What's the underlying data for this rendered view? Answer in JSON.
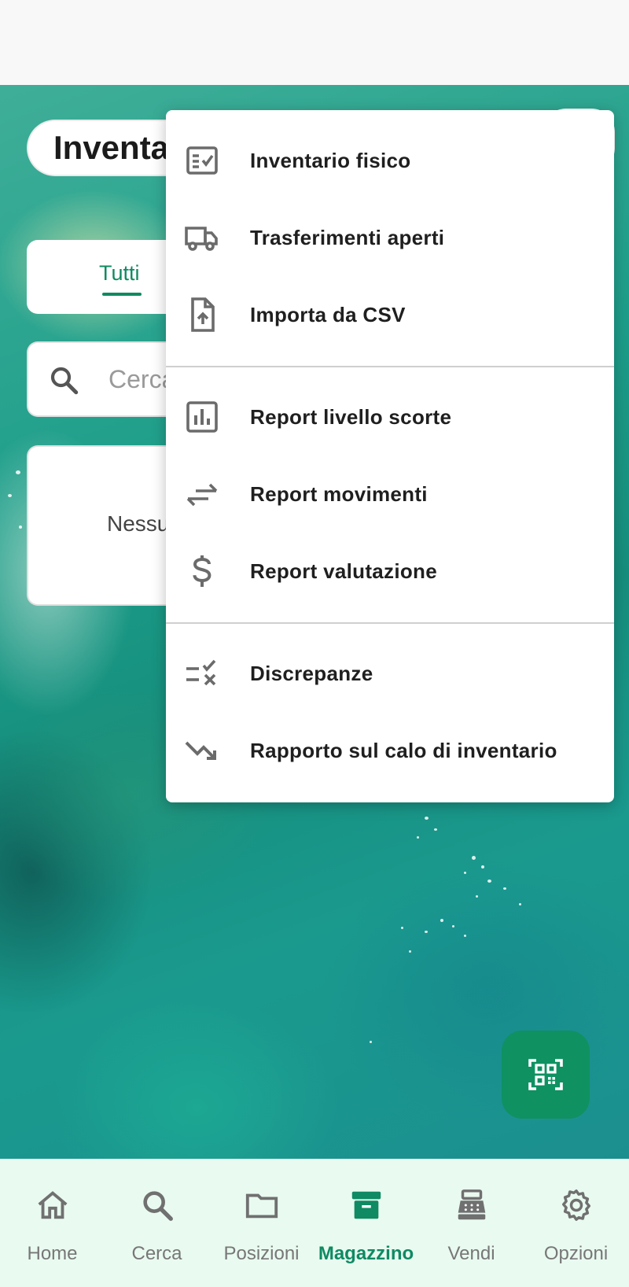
{
  "screen_title": "Inventa",
  "tabs": {
    "active_label": "Tutti"
  },
  "search": {
    "placeholder": "Cerca"
  },
  "empty_state": {
    "text": "Nessu"
  },
  "menu": {
    "items": [
      {
        "label": "Inventario fisico",
        "icon": "checklist-icon"
      },
      {
        "label": "Trasferimenti aperti",
        "icon": "truck-icon"
      },
      {
        "label": "Importa da CSV",
        "icon": "file-upload-icon"
      },
      {
        "label": "Report livello scorte",
        "icon": "bar-chart-icon"
      },
      {
        "label": "Report movimenti",
        "icon": "swap-arrows-icon"
      },
      {
        "label": "Report valutazione",
        "icon": "dollar-icon"
      },
      {
        "label": "Discrepanze",
        "icon": "rule-icon"
      },
      {
        "label": "Rapporto sul calo di inventario",
        "icon": "trending-down-icon"
      }
    ]
  },
  "fab": {
    "icon": "qr-scan-icon"
  },
  "bottom_nav": {
    "active_index": 3,
    "items": [
      {
        "label": "Home",
        "icon": "home-icon"
      },
      {
        "label": "Cerca",
        "icon": "search-icon"
      },
      {
        "label": "Posizioni",
        "icon": "folder-icon"
      },
      {
        "label": "Magazzino",
        "icon": "archive-icon"
      },
      {
        "label": "Vendi",
        "icon": "cash-register-icon"
      },
      {
        "label": "Opzioni",
        "icon": "settings-gear-icon"
      }
    ]
  },
  "colors": {
    "accent": "#0f8a63",
    "fab_background": "#0f9162",
    "nav_background": "#e9faf0",
    "menu_text": "#1f1f1f",
    "icon_gray": "#6b6b6b"
  }
}
